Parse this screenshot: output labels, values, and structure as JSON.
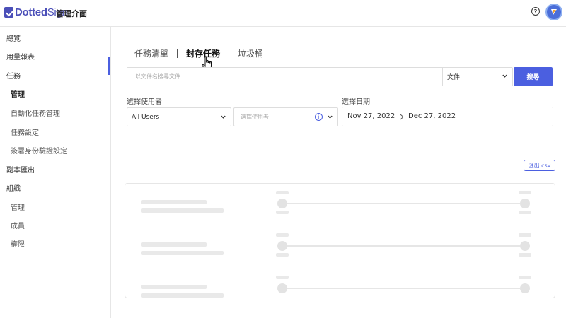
{
  "header": {
    "logo_text_bold": "Dotted",
    "logo_text": "Sign",
    "title": "管理介面",
    "help_icon_glyph": "?"
  },
  "sidebar": {
    "items": [
      {
        "label": "總覽",
        "level": 0,
        "active": false
      },
      {
        "label": "用量報表",
        "level": 0,
        "active": false
      },
      {
        "label": "任務",
        "level": 0,
        "active": false
      },
      {
        "label": "管理",
        "level": 1,
        "active": true
      },
      {
        "label": "自動化任務管理",
        "level": 1,
        "active": false
      },
      {
        "label": "任務設定",
        "level": 1,
        "active": false
      },
      {
        "label": "簽署身份驗證設定",
        "level": 1,
        "active": false
      },
      {
        "label": "副本匯出",
        "level": 0,
        "active": false
      },
      {
        "label": "組織",
        "level": 0,
        "active": false
      },
      {
        "label": "管理",
        "level": 1,
        "active": false
      },
      {
        "label": "成員",
        "level": 1,
        "active": false
      },
      {
        "label": "權限",
        "level": 1,
        "active": false
      }
    ]
  },
  "tabs": [
    {
      "label": "任務清單",
      "active": false
    },
    {
      "label": "封存任務",
      "active": true
    },
    {
      "label": "垃圾桶",
      "active": false
    }
  ],
  "search": {
    "placeholder": "以文件名搜尋文件",
    "value": "",
    "type_selected": "文件",
    "button_label": "搜尋"
  },
  "filters": {
    "user_label": "選擇使用者",
    "user_scope_selected": "All Users",
    "user_placeholder": "選擇使用者",
    "info_glyph": "i",
    "date_label": "選擇日期",
    "date_start": "Nov 27, 2022",
    "date_end": "Dec 27, 2022"
  },
  "export_label": "匯出.csv",
  "colors": {
    "accent": "#4b5fe0",
    "brand": "#4b4fb8",
    "skeleton": "#e9e9e9"
  }
}
